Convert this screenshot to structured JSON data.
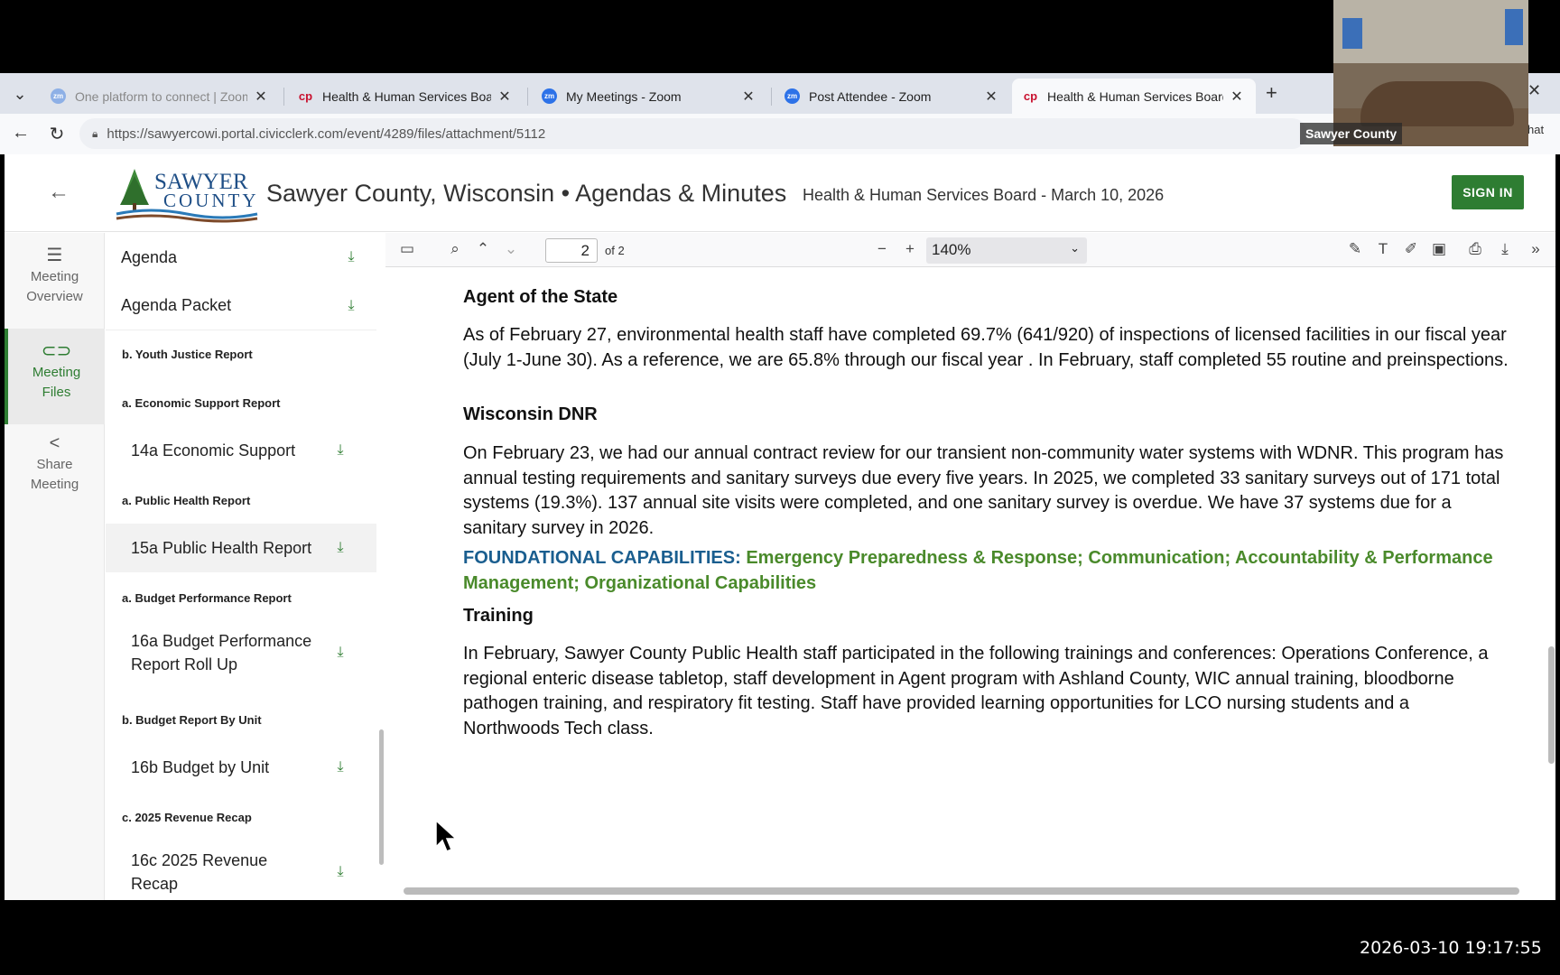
{
  "browser": {
    "tabs": [
      {
        "title": "One platform to connect | Zoom",
        "favicon": "zoom-icon",
        "active": false,
        "dim": true
      },
      {
        "title": "Health & Human Services Board -",
        "favicon": "civicclerk-icon",
        "active": false
      },
      {
        "title": "My Meetings - Zoom",
        "favicon": "zoom-icon",
        "active": false
      },
      {
        "title": "Post Attendee - Zoom",
        "favicon": "zoom-icon",
        "active": false
      },
      {
        "title": "Health & Human Services Board -",
        "favicon": "civicclerk-icon",
        "active": true
      }
    ],
    "url": "https://sawyercowi.portal.civicclerk.com/event/4289/files/attachment/5112"
  },
  "video": {
    "label": "Sawyer County",
    "side_text": "hat"
  },
  "header": {
    "logo_top": "SAWYER",
    "logo_bottom": "COUNTY",
    "site_title": "Sawyer County, Wisconsin • Agendas & Minutes",
    "meeting_title": "Health & Human Services Board - March 10, 2026",
    "signin": "SIGN IN"
  },
  "rail": {
    "overview_line1": "Meeting",
    "overview_line2": "Overview",
    "files_line1": "Meeting",
    "files_line2": "Files",
    "share_line1": "Share",
    "share_line2": "Meeting"
  },
  "files": {
    "agenda": "Agenda",
    "agenda_packet": "Agenda Packet",
    "sec_youth": "b. Youth Justice Report",
    "sec_econ": "a. Economic Support Report",
    "econ_file": "14a Economic Support",
    "sec_public": "a. Public Health Report",
    "public_file": "15a Public Health Report",
    "sec_budget": "a. Budget Performance Report",
    "budget_file_1": "16a Budget Performance",
    "budget_file_2": "Report Roll Up",
    "sec_unit": "b. Budget Report By Unit",
    "unit_file": "16b Budget by Unit",
    "sec_recap": "c. 2025 Revenue Recap",
    "recap_file_1": "16c 2025 Revenue",
    "recap_file_2": "Recap"
  },
  "pdf_toolbar": {
    "page": "2",
    "page_of": "of 2",
    "zoom": "140%"
  },
  "pdf": {
    "h1": "Agent of the State",
    "p1": "As of February 27, environmental health staff have completed 69.7% (641/920) of inspections of licensed facilities in our fiscal year (July 1-June 30).  As a reference, we are 65.8% through our fiscal year .  In February, staff completed 55 routine and preinspections.",
    "h2": "Wisconsin DNR",
    "p2": "On February 23, we had our annual contract review for our transient non-community water systems with WDNR. This program has annual testing requirements and sanitary surveys due every five years.  In 2025, we completed 33 sanitary surveys out of 171 total systems (19.3%). 137 annual site visits were completed, and one sanitary survey is overdue.  We have 37 systems due for a sanitary survey in 2026.",
    "found_label": "FOUNDATIONAL CAPABILITIES:",
    "found_value": "Emergency Preparedness & Response; Communication; Accountability & Performance Management; Organizational Capabilities",
    "h3": "Training",
    "p3": "In February, Sawyer County Public Health staff participated in the following trainings and conferences: Operations Conference, a regional enteric disease tabletop, staff development in Agent program with Ashland County, WIC annual training, bloodborne pathogen training, and respiratory fit testing.  Staff have provided learning opportunities for LCO nursing students and a Northwoods Tech class."
  },
  "clock": "2026-03-10  19:17:55",
  "colors": {
    "brand_green": "#2e7d32",
    "found_blue": "#1a5e8f",
    "found_green": "#4a8a2b"
  }
}
